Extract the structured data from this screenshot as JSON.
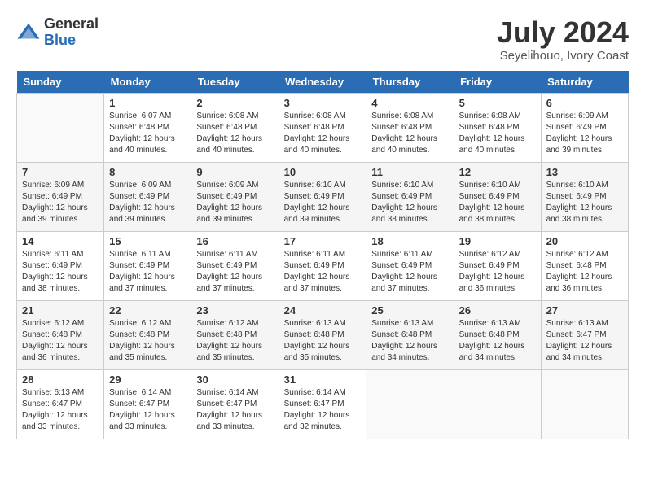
{
  "header": {
    "logo_general": "General",
    "logo_blue": "Blue",
    "month_year": "July 2024",
    "location": "Seyelihouo, Ivory Coast"
  },
  "days_of_week": [
    "Sunday",
    "Monday",
    "Tuesday",
    "Wednesday",
    "Thursday",
    "Friday",
    "Saturday"
  ],
  "weeks": [
    [
      {
        "day": "",
        "sunrise": "",
        "sunset": "",
        "daylight": "",
        "empty": true
      },
      {
        "day": "1",
        "sunrise": "Sunrise: 6:07 AM",
        "sunset": "Sunset: 6:48 PM",
        "daylight": "Daylight: 12 hours and 40 minutes."
      },
      {
        "day": "2",
        "sunrise": "Sunrise: 6:08 AM",
        "sunset": "Sunset: 6:48 PM",
        "daylight": "Daylight: 12 hours and 40 minutes."
      },
      {
        "day": "3",
        "sunrise": "Sunrise: 6:08 AM",
        "sunset": "Sunset: 6:48 PM",
        "daylight": "Daylight: 12 hours and 40 minutes."
      },
      {
        "day": "4",
        "sunrise": "Sunrise: 6:08 AM",
        "sunset": "Sunset: 6:48 PM",
        "daylight": "Daylight: 12 hours and 40 minutes."
      },
      {
        "day": "5",
        "sunrise": "Sunrise: 6:08 AM",
        "sunset": "Sunset: 6:48 PM",
        "daylight": "Daylight: 12 hours and 40 minutes."
      },
      {
        "day": "6",
        "sunrise": "Sunrise: 6:09 AM",
        "sunset": "Sunset: 6:49 PM",
        "daylight": "Daylight: 12 hours and 39 minutes."
      }
    ],
    [
      {
        "day": "7",
        "sunrise": "Sunrise: 6:09 AM",
        "sunset": "Sunset: 6:49 PM",
        "daylight": "Daylight: 12 hours and 39 minutes."
      },
      {
        "day": "8",
        "sunrise": "Sunrise: 6:09 AM",
        "sunset": "Sunset: 6:49 PM",
        "daylight": "Daylight: 12 hours and 39 minutes."
      },
      {
        "day": "9",
        "sunrise": "Sunrise: 6:09 AM",
        "sunset": "Sunset: 6:49 PM",
        "daylight": "Daylight: 12 hours and 39 minutes."
      },
      {
        "day": "10",
        "sunrise": "Sunrise: 6:10 AM",
        "sunset": "Sunset: 6:49 PM",
        "daylight": "Daylight: 12 hours and 39 minutes."
      },
      {
        "day": "11",
        "sunrise": "Sunrise: 6:10 AM",
        "sunset": "Sunset: 6:49 PM",
        "daylight": "Daylight: 12 hours and 38 minutes."
      },
      {
        "day": "12",
        "sunrise": "Sunrise: 6:10 AM",
        "sunset": "Sunset: 6:49 PM",
        "daylight": "Daylight: 12 hours and 38 minutes."
      },
      {
        "day": "13",
        "sunrise": "Sunrise: 6:10 AM",
        "sunset": "Sunset: 6:49 PM",
        "daylight": "Daylight: 12 hours and 38 minutes."
      }
    ],
    [
      {
        "day": "14",
        "sunrise": "Sunrise: 6:11 AM",
        "sunset": "Sunset: 6:49 PM",
        "daylight": "Daylight: 12 hours and 38 minutes."
      },
      {
        "day": "15",
        "sunrise": "Sunrise: 6:11 AM",
        "sunset": "Sunset: 6:49 PM",
        "daylight": "Daylight: 12 hours and 37 minutes."
      },
      {
        "day": "16",
        "sunrise": "Sunrise: 6:11 AM",
        "sunset": "Sunset: 6:49 PM",
        "daylight": "Daylight: 12 hours and 37 minutes."
      },
      {
        "day": "17",
        "sunrise": "Sunrise: 6:11 AM",
        "sunset": "Sunset: 6:49 PM",
        "daylight": "Daylight: 12 hours and 37 minutes."
      },
      {
        "day": "18",
        "sunrise": "Sunrise: 6:11 AM",
        "sunset": "Sunset: 6:49 PM",
        "daylight": "Daylight: 12 hours and 37 minutes."
      },
      {
        "day": "19",
        "sunrise": "Sunrise: 6:12 AM",
        "sunset": "Sunset: 6:49 PM",
        "daylight": "Daylight: 12 hours and 36 minutes."
      },
      {
        "day": "20",
        "sunrise": "Sunrise: 6:12 AM",
        "sunset": "Sunset: 6:48 PM",
        "daylight": "Daylight: 12 hours and 36 minutes."
      }
    ],
    [
      {
        "day": "21",
        "sunrise": "Sunrise: 6:12 AM",
        "sunset": "Sunset: 6:48 PM",
        "daylight": "Daylight: 12 hours and 36 minutes."
      },
      {
        "day": "22",
        "sunrise": "Sunrise: 6:12 AM",
        "sunset": "Sunset: 6:48 PM",
        "daylight": "Daylight: 12 hours and 35 minutes."
      },
      {
        "day": "23",
        "sunrise": "Sunrise: 6:12 AM",
        "sunset": "Sunset: 6:48 PM",
        "daylight": "Daylight: 12 hours and 35 minutes."
      },
      {
        "day": "24",
        "sunrise": "Sunrise: 6:13 AM",
        "sunset": "Sunset: 6:48 PM",
        "daylight": "Daylight: 12 hours and 35 minutes."
      },
      {
        "day": "25",
        "sunrise": "Sunrise: 6:13 AM",
        "sunset": "Sunset: 6:48 PM",
        "daylight": "Daylight: 12 hours and 34 minutes."
      },
      {
        "day": "26",
        "sunrise": "Sunrise: 6:13 AM",
        "sunset": "Sunset: 6:48 PM",
        "daylight": "Daylight: 12 hours and 34 minutes."
      },
      {
        "day": "27",
        "sunrise": "Sunrise: 6:13 AM",
        "sunset": "Sunset: 6:47 PM",
        "daylight": "Daylight: 12 hours and 34 minutes."
      }
    ],
    [
      {
        "day": "28",
        "sunrise": "Sunrise: 6:13 AM",
        "sunset": "Sunset: 6:47 PM",
        "daylight": "Daylight: 12 hours and 33 minutes."
      },
      {
        "day": "29",
        "sunrise": "Sunrise: 6:14 AM",
        "sunset": "Sunset: 6:47 PM",
        "daylight": "Daylight: 12 hours and 33 minutes."
      },
      {
        "day": "30",
        "sunrise": "Sunrise: 6:14 AM",
        "sunset": "Sunset: 6:47 PM",
        "daylight": "Daylight: 12 hours and 33 minutes."
      },
      {
        "day": "31",
        "sunrise": "Sunrise: 6:14 AM",
        "sunset": "Sunset: 6:47 PM",
        "daylight": "Daylight: 12 hours and 32 minutes."
      },
      {
        "day": "",
        "empty": true
      },
      {
        "day": "",
        "empty": true
      },
      {
        "day": "",
        "empty": true
      }
    ]
  ]
}
